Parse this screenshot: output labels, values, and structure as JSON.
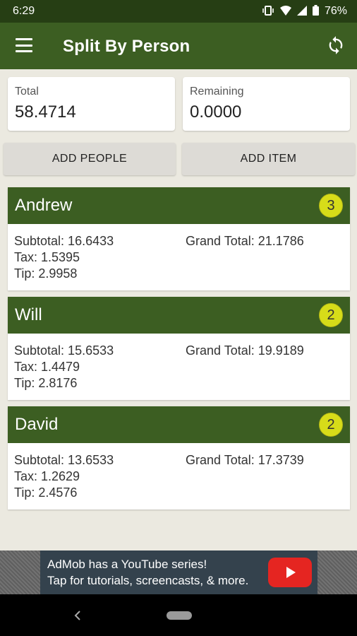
{
  "status_bar": {
    "time": "6:29",
    "battery": "76%"
  },
  "app_bar": {
    "title": "Split By Person"
  },
  "summary": {
    "total_label": "Total",
    "total_value": "58.4714",
    "remaining_label": "Remaining",
    "remaining_value": "0.0000"
  },
  "actions": {
    "add_people": "ADD PEOPLE",
    "add_item": "ADD ITEM"
  },
  "people": [
    {
      "name": "Andrew",
      "count": "3",
      "subtotal": "Subtotal: 16.6433",
      "tax": "Tax: 1.5395",
      "tip": "Tip: 2.9958",
      "grand_total": "Grand Total: 21.1786"
    },
    {
      "name": "Will",
      "count": "2",
      "subtotal": "Subtotal: 15.6533",
      "tax": "Tax: 1.4479",
      "tip": "Tip: 2.8176",
      "grand_total": "Grand Total: 19.9189"
    },
    {
      "name": "David",
      "count": "2",
      "subtotal": "Subtotal: 13.6533",
      "tax": "Tax: 1.2629",
      "tip": "Tip: 2.4576",
      "grand_total": "Grand Total: 17.3739"
    }
  ],
  "ad": {
    "line1": "AdMob has a YouTube series!",
    "line2": "Tap for tutorials, screencasts, & more."
  },
  "colors": {
    "primary": "#3c5e22",
    "primary_dark": "#263e14",
    "badge": "#d7dc19",
    "background": "#ebe9e0"
  }
}
